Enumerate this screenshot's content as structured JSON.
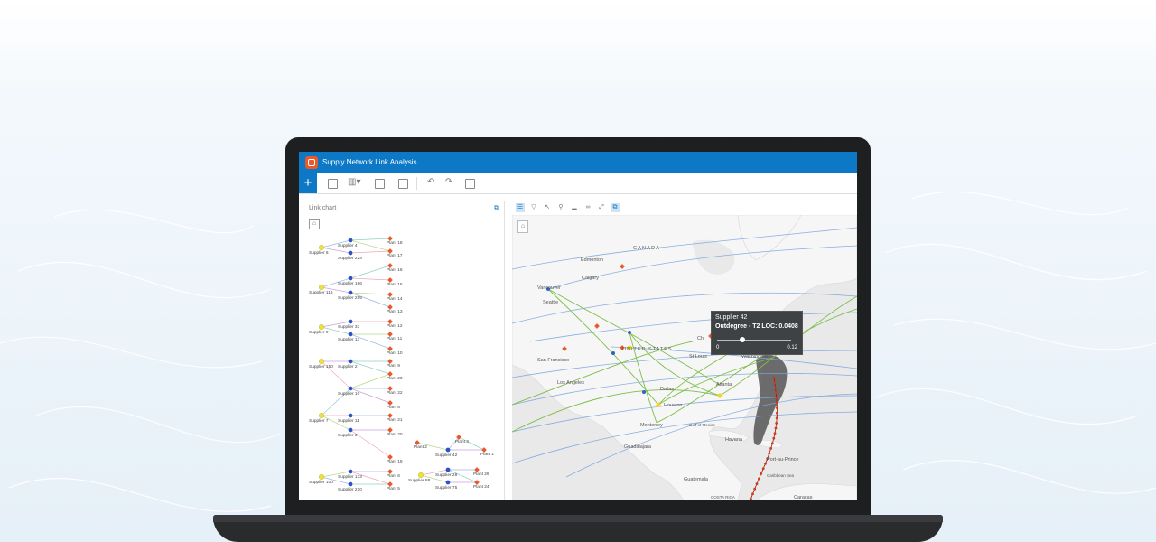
{
  "app": {
    "title": "Supply Network Link Analysis",
    "add_label": "+"
  },
  "left_panel": {
    "title": "Link chart"
  },
  "map": {
    "labels": {
      "canada": "CANADA",
      "edmonton": "Edmonton",
      "calgary": "Calgary",
      "vancouver": "Vancouver",
      "seattle": "Seattle",
      "chicago": "Chi",
      "united_states": "UNITED STATES",
      "st_louis": "St Louis",
      "washington": "Washington",
      "san_francisco": "San Francisco",
      "los_angeles": "Los Angeles",
      "dallas": "Dallas",
      "atlanta": "Atlanta",
      "houston": "Houston",
      "monterrey": "Monterrey",
      "gulf": "Gulf of Mexico",
      "havana": "Havana",
      "guadalajara": "Guadalajara",
      "port_au_prince": "Port-au-Prince",
      "guatemala": "Guatemala",
      "caribbean": "Caribbean Sea",
      "caracas": "Caracas",
      "costa_rica": "COSTA RICA"
    }
  },
  "popup": {
    "title": "Supplier 42",
    "metric": "Outdegree - T2 LOC: 0.0408",
    "range_min": "0",
    "range_max": "0.12",
    "value_fraction": 0.34
  },
  "link_chart": {
    "suppliers": [
      "Supplier 4",
      "Supplier 224",
      "Supplier 6",
      "Supplier 166",
      "Supplier 116",
      "Supplier 255",
      "Supplier 33",
      "Supplier 9",
      "Supplier 13",
      "Supplier 2",
      "Supplier 150",
      "Supplier 10",
      "Supplier 7",
      "Supplier 11",
      "Supplier 3",
      "Supplier 133",
      "Supplier 100",
      "Supplier 210",
      "Supplier 42",
      "Supplier 28",
      "Supplier 88",
      "Supplier 75"
    ],
    "plants": [
      "Plant 18",
      "Plant 17",
      "Plant 16",
      "Plant 15",
      "Plant 14",
      "Plant 13",
      "Plant 12",
      "Plant 11",
      "Plant 10",
      "Plant 9",
      "Plant 23",
      "Plant 22",
      "Plant 8",
      "Plant 21",
      "Plant 20",
      "Plant 19",
      "Plant 6",
      "Plant 5",
      "Plant 2",
      "Plant 3",
      "Plant 1",
      "Plant 26",
      "Plant 24"
    ]
  }
}
